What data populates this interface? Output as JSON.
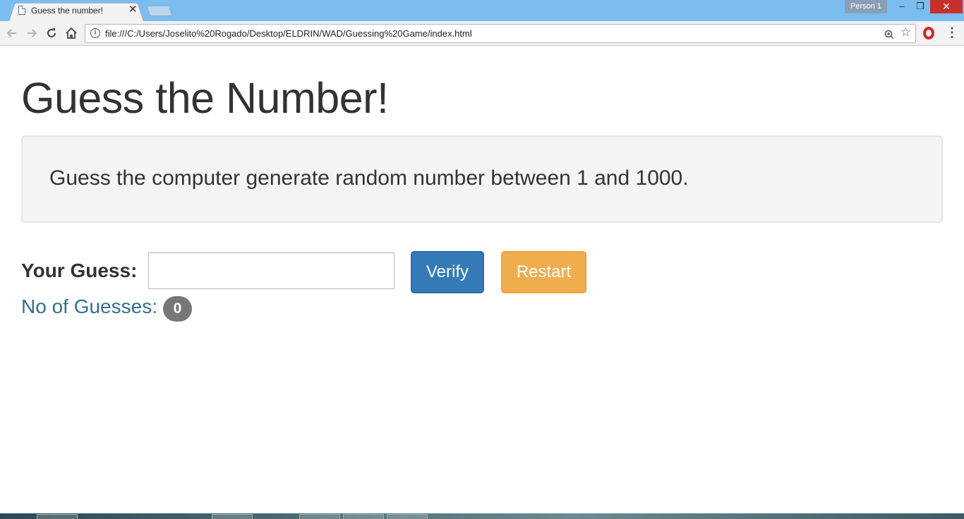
{
  "browser": {
    "tab_title": "Guess the number!",
    "tab_close": "✕",
    "profile_name": "Person 1",
    "url": "file:///C:/Users/Joselito%20Rogado/Desktop/ELDRIN/WAD/Guessing%20Game/index.html",
    "icons": {
      "back": "back-arrow-icon",
      "forward": "forward-arrow-icon",
      "reload": "reload-icon",
      "home": "home-icon",
      "info": "info-icon",
      "zoom": "zoom-icon",
      "bookmark": "star-icon",
      "extension": "opera-icon",
      "menu": "kebab-menu-icon"
    },
    "window_buttons": {
      "minimize": "–",
      "maximize": "❐",
      "close": "✕"
    }
  },
  "page": {
    "title": "Guess the Number!",
    "description": "Guess the computer generate random number between 1 and 1000.",
    "guess_label": "Your Guess:",
    "guess_value": "",
    "verify_label": "Verify",
    "restart_label": "Restart",
    "count_label": "No of Guesses:",
    "count_value": "0"
  },
  "colors": {
    "verify": "#337ab7",
    "restart": "#f0ad4e",
    "count_label": "#31708f",
    "badge": "#777777",
    "titlebar": "#7cbdf0"
  }
}
